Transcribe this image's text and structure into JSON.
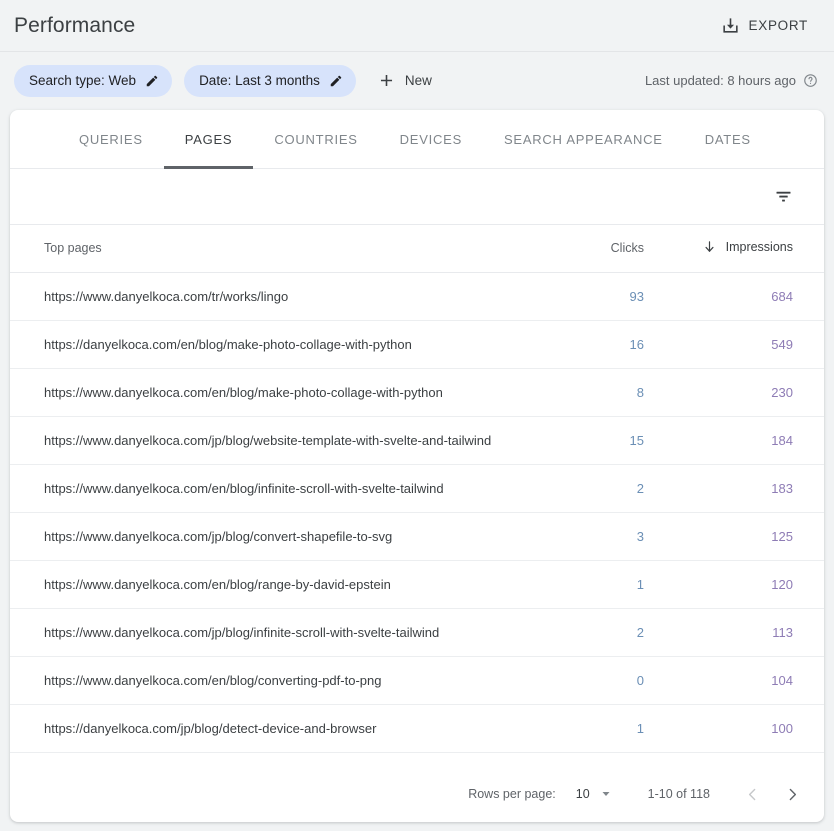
{
  "header": {
    "title": "Performance",
    "export_label": "EXPORT",
    "export_icon": "download-icon"
  },
  "filters": {
    "chips": [
      {
        "label": "Search type: Web",
        "icon": "pencil-icon"
      },
      {
        "label": "Date: Last 3 months",
        "icon": "pencil-icon"
      }
    ],
    "new_label": "New",
    "new_icon": "plus-icon",
    "last_updated": "Last updated: 8 hours ago",
    "help_icon": "help-circle-icon"
  },
  "tabs": [
    {
      "label": "QUERIES",
      "active": false
    },
    {
      "label": "PAGES",
      "active": true
    },
    {
      "label": "COUNTRIES",
      "active": false
    },
    {
      "label": "DEVICES",
      "active": false
    },
    {
      "label": "SEARCH APPEARANCE",
      "active": false
    },
    {
      "label": "DATES",
      "active": false
    }
  ],
  "toolbar": {
    "filter_icon": "filter-funnel-icon"
  },
  "table": {
    "columns": {
      "page": "Top pages",
      "clicks": "Clicks",
      "impressions": "Impressions"
    },
    "sort": {
      "column": "Impressions",
      "direction": "desc",
      "icon": "arrow-down-icon"
    },
    "rows": [
      {
        "page": "https://www.danyelkoca.com/tr/works/lingo",
        "clicks": "93",
        "impressions": "684"
      },
      {
        "page": "https://danyelkoca.com/en/blog/make-photo-collage-with-python",
        "clicks": "16",
        "impressions": "549"
      },
      {
        "page": "https://www.danyelkoca.com/en/blog/make-photo-collage-with-python",
        "clicks": "8",
        "impressions": "230"
      },
      {
        "page": "https://www.danyelkoca.com/jp/blog/website-template-with-svelte-and-tailwind",
        "clicks": "15",
        "impressions": "184"
      },
      {
        "page": "https://www.danyelkoca.com/en/blog/infinite-scroll-with-svelte-tailwind",
        "clicks": "2",
        "impressions": "183"
      },
      {
        "page": "https://www.danyelkoca.com/jp/blog/convert-shapefile-to-svg",
        "clicks": "3",
        "impressions": "125"
      },
      {
        "page": "https://www.danyelkoca.com/en/blog/range-by-david-epstein",
        "clicks": "1",
        "impressions": "120"
      },
      {
        "page": "https://www.danyelkoca.com/jp/blog/infinite-scroll-with-svelte-tailwind",
        "clicks": "2",
        "impressions": "113"
      },
      {
        "page": "https://www.danyelkoca.com/en/blog/converting-pdf-to-png",
        "clicks": "0",
        "impressions": "104"
      },
      {
        "page": "https://danyelkoca.com/jp/blog/detect-device-and-browser",
        "clicks": "1",
        "impressions": "100"
      }
    ]
  },
  "pagination": {
    "rows_per_page_label": "Rows per page:",
    "rows_per_page_value": "10",
    "dropdown_icon": "chevron-down-icon",
    "range_label": "1-10 of 118",
    "prev_icon": "chevron-left-icon",
    "next_icon": "chevron-right-icon"
  },
  "colors": {
    "clicks": "#6b8fb5",
    "impressions": "#8e7cb5",
    "chip_bg": "#d7e3fb",
    "page_bg": "#f1f3f4"
  }
}
